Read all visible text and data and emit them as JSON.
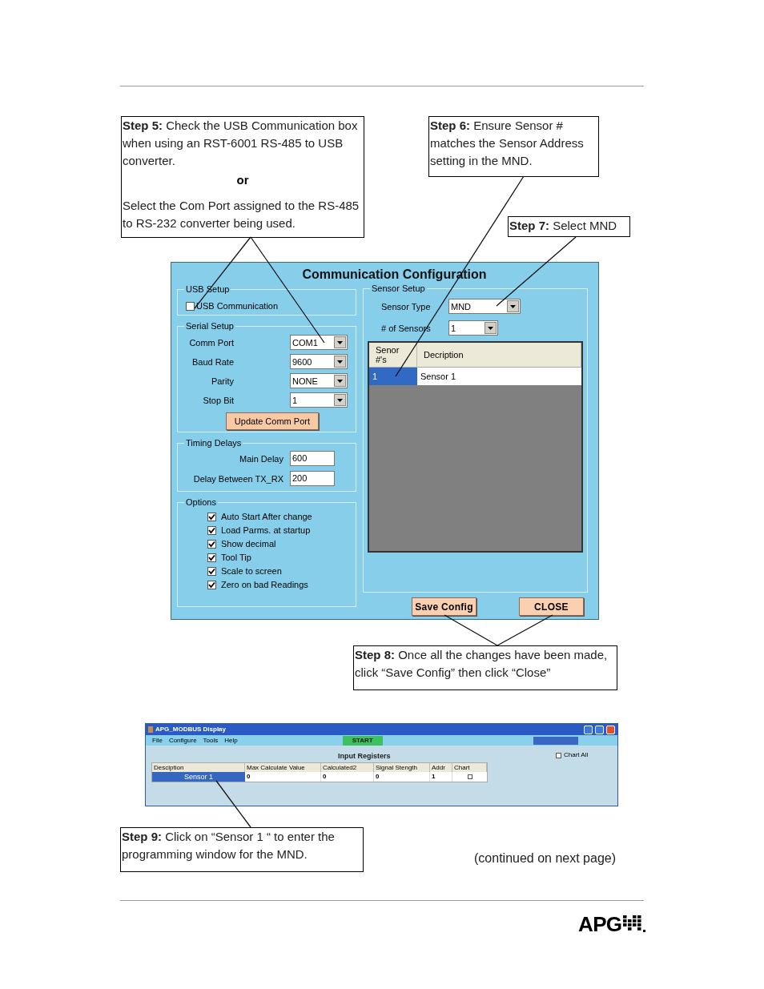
{
  "callouts": [
    {
      "kind": "step5",
      "paragraphs": [
        "**Step 5:** Check the USB Communication box when using an RST-6001 RS-485 to USB converter.",
        "or",
        "Select the Com Port assigned to the RS-485 to RS-232 converter being used."
      ]
    },
    {
      "kind": "step6",
      "paragraphs": [
        "**Step 6:** Ensure Sensor # matches the Sensor Address setting in the MND."
      ]
    },
    {
      "kind": "step7",
      "paragraphs": [
        "**Step 7:** Select MND"
      ]
    },
    {
      "kind": "step8",
      "paragraphs": [
        "**Step 8:** Once all the changes have been made, click “Save Config” then click “Close”"
      ]
    },
    {
      "kind": "step9",
      "paragraphs": [
        "**Step 9:** Click on “Sensor 1 “ to enter the programming window for the MND."
      ]
    }
  ],
  "dialog": {
    "title": "Communication Configuration",
    "usb_setup": {
      "label": "USB Setup",
      "checkbox": {
        "label": "USB Communication",
        "checked": false
      }
    },
    "serial_setup": {
      "label": "Serial Setup",
      "fields": [
        {
          "label": "Comm Port",
          "value": "COM1"
        },
        {
          "label": "Baud Rate",
          "value": "9600"
        },
        {
          "label": "Parity",
          "value": "NONE"
        },
        {
          "label": "Stop Bit",
          "value": "1"
        }
      ],
      "button": "Update Comm Port"
    },
    "timing_delays": {
      "label": "Timing Delays",
      "fields": [
        {
          "label": "Main Delay",
          "value": "600"
        },
        {
          "label": "Delay Between TX_RX",
          "value": "200"
        }
      ]
    },
    "options": {
      "label": "Options",
      "items": [
        {
          "label": "Auto Start After change",
          "checked": true
        },
        {
          "label": "Load Parms. at startup",
          "checked": true
        },
        {
          "label": "Show decimal",
          "checked": true
        },
        {
          "label": "Tool Tip",
          "checked": true
        },
        {
          "label": "Scale to screen",
          "checked": true
        },
        {
          "label": "Zero on bad Readings",
          "checked": true
        }
      ]
    },
    "sensor_setup": {
      "label": "Sensor Setup",
      "sensor_type": {
        "label": "Sensor Type",
        "value": "MND"
      },
      "num_sensors": {
        "label": "# of Sensors",
        "value": "1"
      },
      "table": {
        "columns": [
          "Senor #'s",
          "Decription"
        ],
        "rows": [
          {
            "cells": [
              "1",
              "Sensor 1"
            ],
            "selected": true
          }
        ]
      }
    },
    "buttons": [
      "Save Config",
      "CLOSE"
    ]
  },
  "modbus_window": {
    "title": "APG_MODBUS Display",
    "menu": [
      "File",
      "Configure",
      "Tools",
      "Help"
    ],
    "start_button": "START",
    "heading": "Input Registers",
    "chart_all": {
      "label": "Chart All",
      "checked": false
    },
    "table": {
      "columns": [
        "Desciption",
        "Max Calculate Value",
        "Calculated2",
        "Signal Stength",
        "Addr",
        "Chart"
      ],
      "rows": [
        {
          "description": "Sensor 1",
          "selected": true,
          "values": [
            "0",
            "0",
            "0",
            "1"
          ],
          "chart": false
        }
      ]
    }
  },
  "continued_note": "(continued on next page)",
  "logo": "APG"
}
